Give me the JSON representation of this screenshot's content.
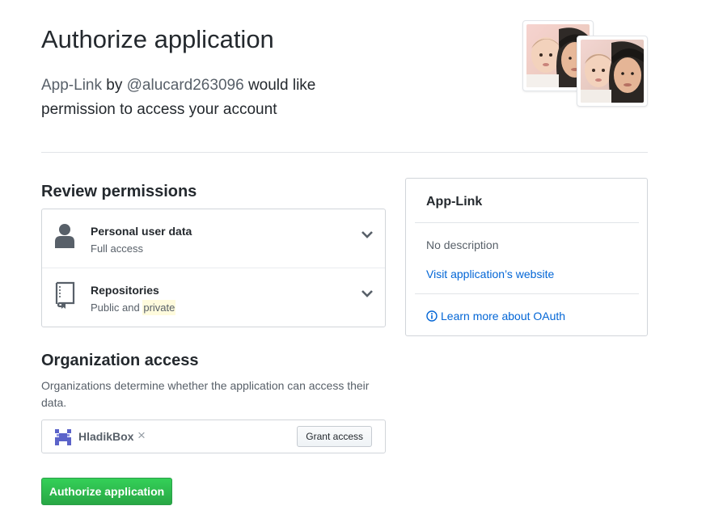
{
  "header": {
    "title": "Authorize application",
    "app_name": "App-Link",
    "by_text": "by",
    "author": "@alucard263096",
    "lead_rest_1": "would like",
    "lead_rest_2": "permission to access your account"
  },
  "permissions": {
    "heading": "Review permissions",
    "items": [
      {
        "title": "Personal user data",
        "subtitle": "Full access",
        "icon": "person-icon"
      },
      {
        "title": "Repositories",
        "subtitle_prefix": "Public and",
        "subtitle_highlight": "private",
        "icon": "repo-icon"
      }
    ]
  },
  "organizations": {
    "heading": "Organization access",
    "description": "Organizations determine whether the application can access their data.",
    "items": [
      {
        "name": "HladikBox",
        "remove_glyph": "×",
        "grant_label": "Grant access"
      }
    ]
  },
  "authorize_label": "Authorize application",
  "app_card": {
    "name": "App-Link",
    "description": "No description",
    "website_link": "Visit application’s website",
    "oauth_link": "Learn more about OAuth"
  },
  "colors": {
    "link": "#0366d6",
    "primary_button": "#28a745",
    "highlight": "#fffbdd"
  }
}
